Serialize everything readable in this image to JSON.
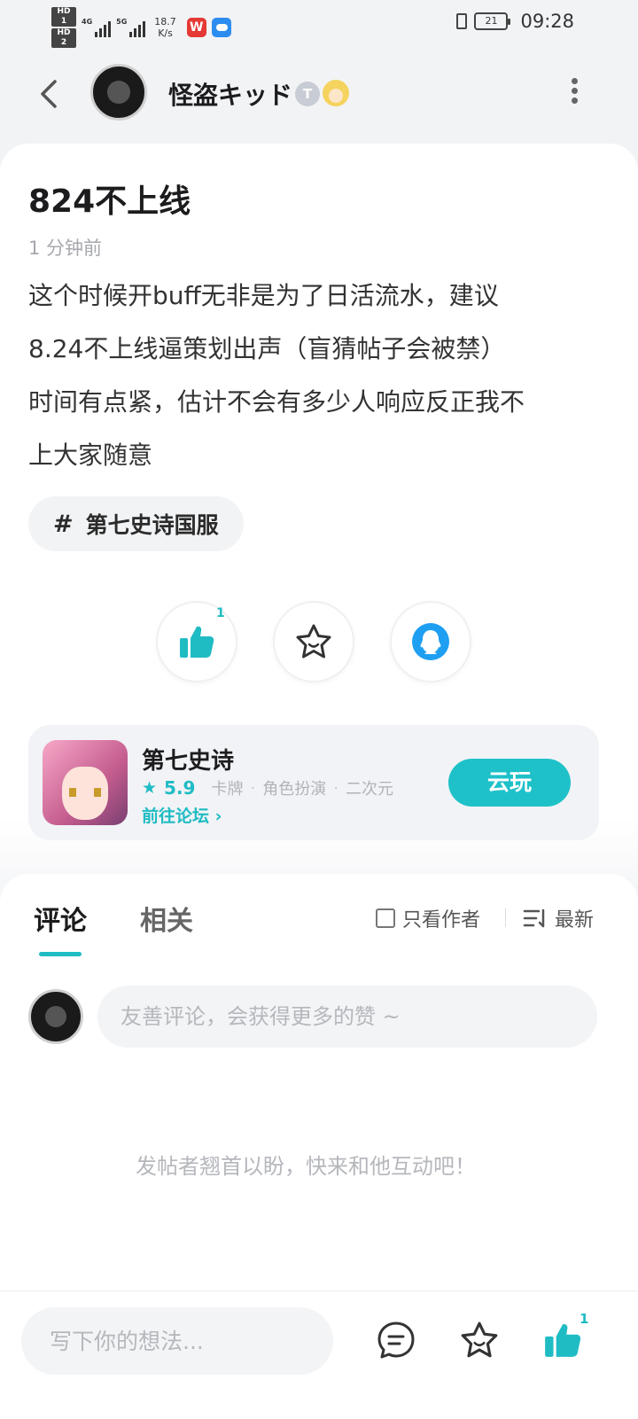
{
  "status_bar": {
    "hd1": "HD 1",
    "hd2": "HD 2",
    "sig1_label": "4G",
    "sig2_label": "5G",
    "speed_value": "18.7",
    "speed_unit": "K/s",
    "app_w_label": "W",
    "battery": "21",
    "time": "09:28"
  },
  "header": {
    "author_name": "怪盗キッド",
    "badge_letter": "T"
  },
  "post": {
    "title": "824不上线",
    "time": "1 分钟前",
    "body_lines": [
      "这个时候开buff无非是为了日活流水，建议",
      "8.24不上线逼策划出声（盲猜帖子会被禁）",
      "时间有点紧，估计不会有多少人响应反正我不",
      "上大家随意"
    ],
    "tag_symbol": "#",
    "tag": "第七史诗国服",
    "like_count": "1"
  },
  "game_card": {
    "name": "第七史诗",
    "star": "★",
    "rating": "5.9",
    "genres": [
      "卡牌",
      "角色扮演",
      "二次元"
    ],
    "separator": "·",
    "forum_link": "前往论坛",
    "link_chevron": "›",
    "play_button": "云玩"
  },
  "comments": {
    "tabs": [
      "评论",
      "相关"
    ],
    "only_author": "只看作者",
    "sort": "最新",
    "input_placeholder": "友善评论，会获得更多的赞 ~",
    "empty_message": "发帖者翘首以盼，快来和他互动吧！"
  },
  "bottom_bar": {
    "input_placeholder": "写下你的想法...",
    "like_count": "1"
  },
  "colors": {
    "accent": "#1fbcc4",
    "background": "#f2f3f5",
    "text_primary": "#1c1c1e",
    "text_secondary": "#a6a8ad"
  }
}
